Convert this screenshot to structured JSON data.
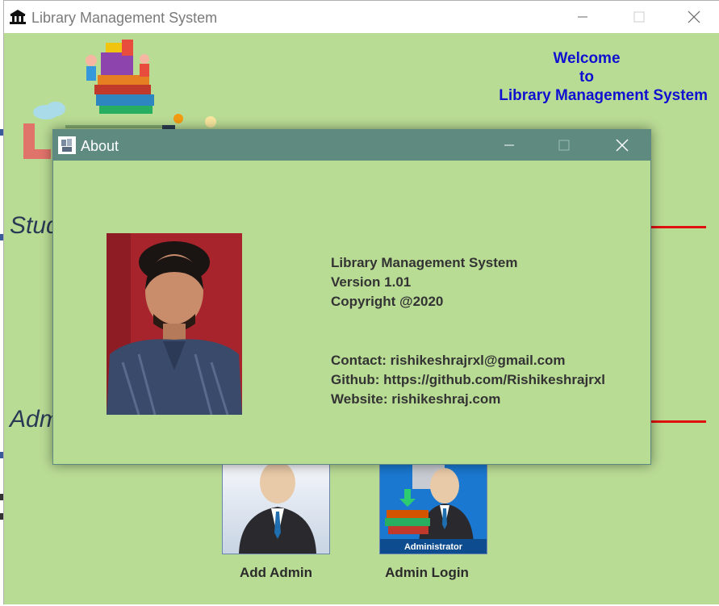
{
  "main_window": {
    "title": "Library Management System",
    "welcome": {
      "line1": "Welcome",
      "line2": "to",
      "line3": "Library Management System"
    },
    "sections": {
      "student_partial": "Stud",
      "admin_partial": "Adm"
    },
    "tiles": [
      {
        "label": "Add Admin",
        "icon": "add-admin-icon"
      },
      {
        "label": "Admin Login",
        "icon": "admin-login-icon"
      }
    ],
    "tile_image_text": "Administrator"
  },
  "about_dialog": {
    "title": "About",
    "info_lines": [
      "Library Management System",
      "Version 1.01",
      "Copyright @2020"
    ],
    "contact_lines": [
      "Contact: rishikeshrajrxl@gmail.com",
      "Github: https://github.com/Rishikeshrajrxl",
      "Website: rishikeshraj.com"
    ]
  },
  "colors": {
    "window_bg": "#b9dc95",
    "about_titlebar": "#5e8a80",
    "welcome_text": "#1010d0",
    "section_line": "#e01010"
  }
}
